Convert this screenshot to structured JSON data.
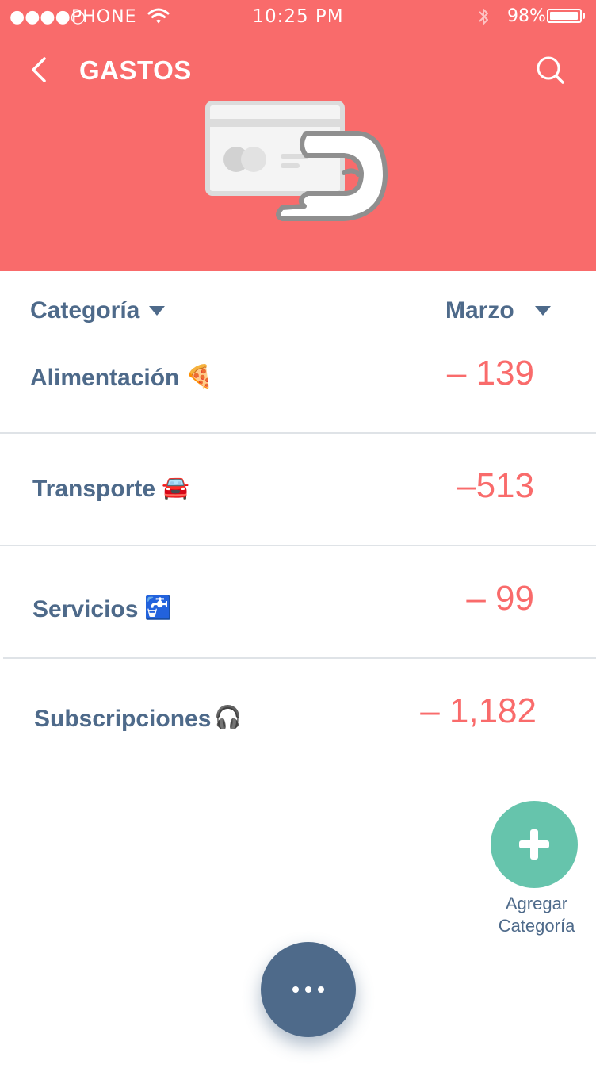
{
  "status_bar": {
    "signal": "●●●●○",
    "carrier": "PHONE",
    "time": "10:25 PM",
    "battery_percent": "98%",
    "battery_level": 0.98,
    "wifi_icon": "wifi-icon",
    "bluetooth_icon": "bluetooth-icon"
  },
  "header": {
    "title": "GASTOS",
    "back_icon": "chevron-left-icon",
    "search_icon": "search-icon",
    "hero_icon": "card-payment-icon",
    "background_color": "#f96b6b"
  },
  "columns": {
    "category_label": "Categoría",
    "month_label": "Marzo"
  },
  "categories": [
    {
      "label": "Alimentación",
      "emoji": "🍕",
      "amount": "– 139"
    },
    {
      "label": "Transporte",
      "emoji": "🚘",
      "amount": "–513"
    },
    {
      "label": "Servicios",
      "emoji": "🚰",
      "amount": "– 99"
    },
    {
      "label": "Subscripciones",
      "emoji": "🎧",
      "amount": "– 1,182"
    }
  ],
  "add_category": {
    "label_line1": "Agregar",
    "label_line2": "Categoría",
    "icon": "plus-icon",
    "color": "#66c4ac"
  },
  "more_button": {
    "icon": "more-dots-icon",
    "color": "#4e6a8a"
  },
  "colors": {
    "text_primary": "#4e6a8a",
    "amount_negative": "#f96b6b"
  }
}
